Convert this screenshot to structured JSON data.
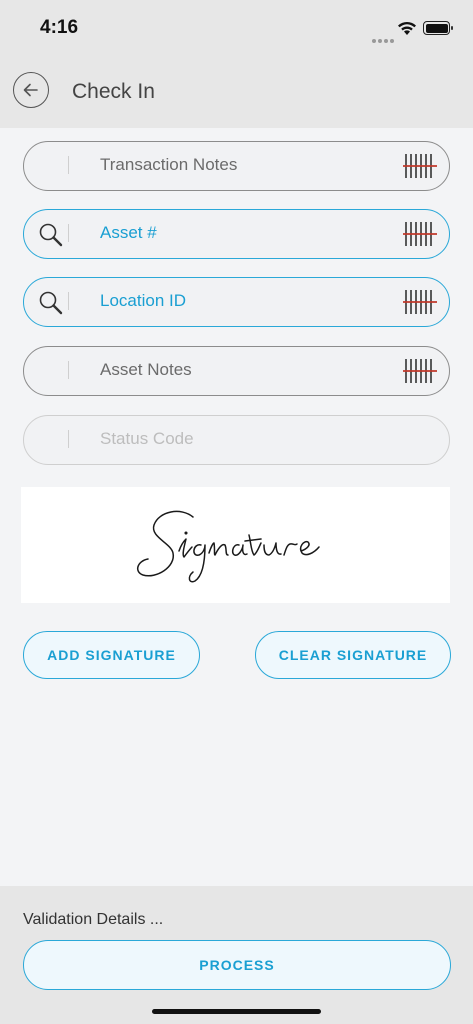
{
  "status_bar": {
    "time": "4:16"
  },
  "header": {
    "title": "Check In",
    "back_icon": "back-arrow-icon"
  },
  "fields": [
    {
      "label": "Transaction Notes",
      "state": "default",
      "leading_icon": null,
      "trailing_icon": "barcode-scan-icon"
    },
    {
      "label": "Asset #",
      "state": "active",
      "leading_icon": "search-icon",
      "trailing_icon": "barcode-scan-icon"
    },
    {
      "label": "Location ID",
      "state": "active",
      "leading_icon": "search-icon",
      "trailing_icon": "barcode-scan-icon"
    },
    {
      "label": "Asset Notes",
      "state": "default",
      "leading_icon": null,
      "trailing_icon": "barcode-scan-icon"
    },
    {
      "label": "Status Code",
      "state": "disabled",
      "leading_icon": null,
      "trailing_icon": null
    }
  ],
  "signature": {
    "text": "Signature"
  },
  "buttons": {
    "add_signature": "ADD SIGNATURE",
    "clear_signature": "CLEAR SIGNATURE",
    "process": "PROCESS"
  },
  "footer": {
    "validation": "Validation Details ..."
  },
  "colors": {
    "accent": "#1a9fd2",
    "border_gray": "#8c8c8c",
    "scan_red": "#c0392b",
    "background": "#f3f4f6",
    "bar_gray": "#e7e7e7"
  }
}
